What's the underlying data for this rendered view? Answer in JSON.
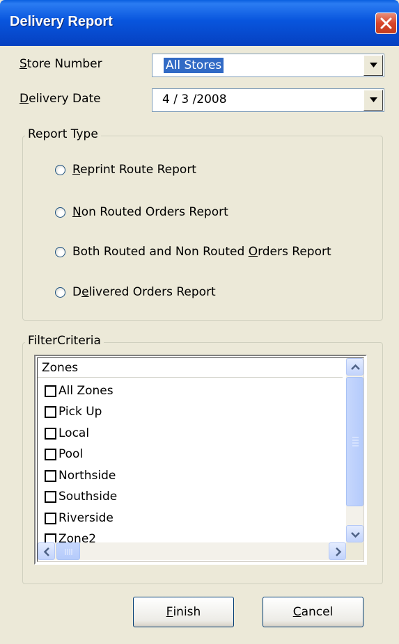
{
  "window": {
    "title": "Delivery Report"
  },
  "store": {
    "label_key": "S",
    "label_rest": "tore Number",
    "value": "All Stores"
  },
  "date": {
    "label_key": "D",
    "label_rest": "elivery Date",
    "value": "4 / 3 /2008"
  },
  "report_type": {
    "title": "Report Type",
    "options": [
      {
        "pre": "",
        "key": "R",
        "post": "eprint Route Report"
      },
      {
        "pre": "",
        "key": "N",
        "post": "on Routed Orders Report"
      },
      {
        "pre": "Both Routed and Non Routed ",
        "key": "O",
        "post": "rders Report"
      },
      {
        "pre": "D",
        "key": "e",
        "post": "livered Orders Report"
      }
    ]
  },
  "filter": {
    "title": "FilterCriteria",
    "column_header": "Zones",
    "zones": [
      "All Zones",
      "Pick Up",
      "Local",
      "Pool",
      "Northside",
      "Southside",
      "Riverside",
      "Zone2"
    ]
  },
  "buttons": {
    "finish": {
      "key": "F",
      "rest": "inish"
    },
    "cancel": {
      "key": "C",
      "rest": "ancel"
    }
  },
  "icons": {
    "close": "close-x-icon",
    "dropdown": "chevron-down-icon",
    "scroll_up": "arrow-up-icon",
    "scroll_down": "arrow-down-icon",
    "scroll_left": "arrow-left-icon",
    "scroll_right": "arrow-right-icon"
  },
  "colors": {
    "titlebar": "#0855dd",
    "face": "#ece9d8",
    "selection": "#316ac5",
    "close": "#d8452a"
  }
}
